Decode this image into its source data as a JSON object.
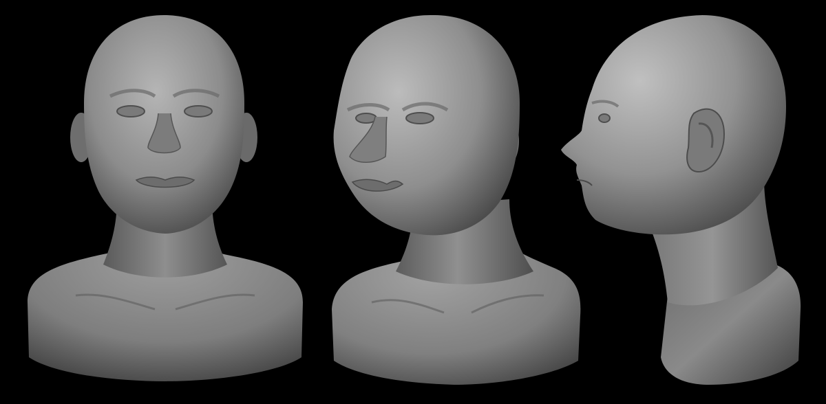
{
  "scene": {
    "background_color": "#000000",
    "clay_color": "#8a8a8a",
    "clay_highlight": "#b8b8b8",
    "clay_shadow": "#3a3a3a"
  },
  "views": [
    {
      "name": "front",
      "label": ""
    },
    {
      "name": "three-quarter",
      "label": ""
    },
    {
      "name": "profile",
      "label": ""
    }
  ]
}
